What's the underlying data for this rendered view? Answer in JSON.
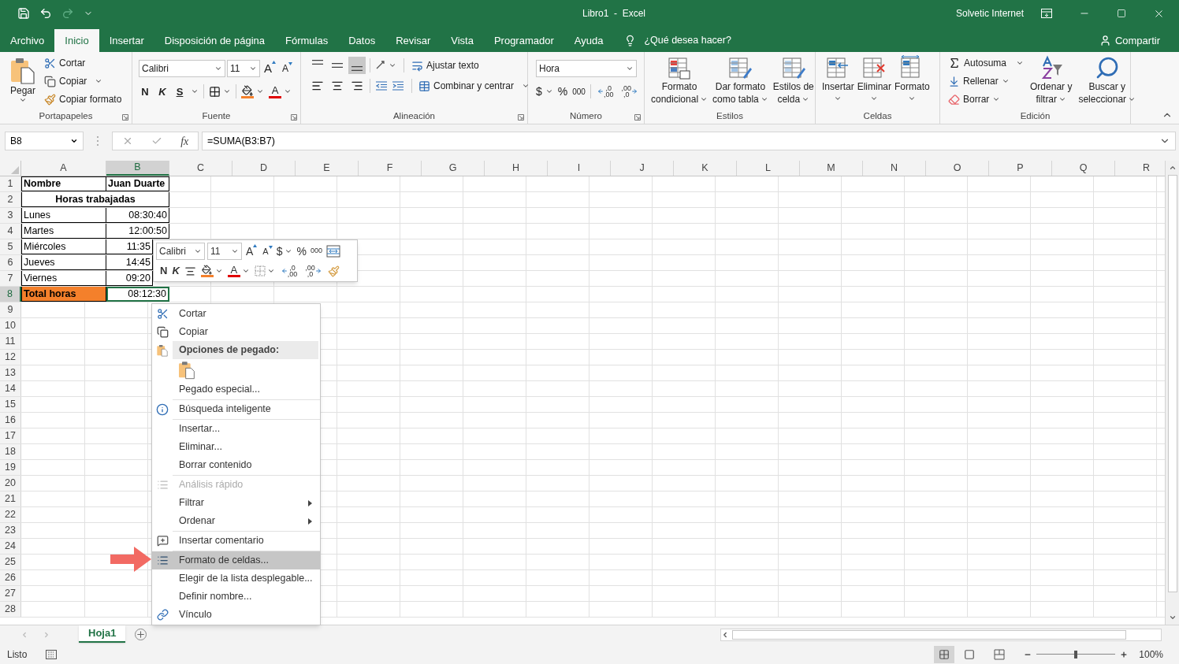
{
  "title_bar": {
    "title": "Libro1  -  Excel",
    "user": "Solvetic Internet"
  },
  "menu_tabs": [
    {
      "label": "Archivo",
      "selected": false
    },
    {
      "label": "Inicio",
      "selected": true
    },
    {
      "label": "Insertar",
      "selected": false
    },
    {
      "label": "Disposición de página",
      "selected": false
    },
    {
      "label": "Fórmulas",
      "selected": false
    },
    {
      "label": "Datos",
      "selected": false
    },
    {
      "label": "Revisar",
      "selected": false
    },
    {
      "label": "Vista",
      "selected": false
    },
    {
      "label": "Programador",
      "selected": false
    },
    {
      "label": "Ayuda",
      "selected": false
    }
  ],
  "tell_me": {
    "placeholder": "¿Qué desea hacer?"
  },
  "share": "Compartir",
  "ribbon": {
    "clipboard": {
      "label": "Portapapeles",
      "paste": "Pegar",
      "cut": "Cortar",
      "copy": "Copiar",
      "format_painter": "Copiar formato"
    },
    "font": {
      "label": "Fuente",
      "family": "Calibri",
      "size": "11",
      "grow": "A",
      "shrink": "A",
      "bold": "N",
      "italic": "K",
      "underline": "S",
      "font_color": "A"
    },
    "alignment": {
      "label": "Alineación",
      "vertical_align": [
        {
          "selected": false
        },
        {
          "selected": false
        },
        {
          "selected": true
        }
      ],
      "wrap": "Ajustar texto",
      "merge": "Combinar y centrar"
    },
    "number": {
      "label": "Número",
      "format": "Hora",
      "currency": "$",
      "percent": "%",
      "thousands": "000",
      "increase_decimal": [
        ",0",
        ",00"
      ],
      "decrease_decimal": [
        ",00",
        ",0"
      ]
    },
    "styles": {
      "label": "Estilos",
      "buttons": [
        {
          "lines": [
            "Formato",
            "condicional"
          ]
        },
        {
          "lines": [
            "Dar formato",
            "como tabla"
          ]
        },
        {
          "lines": [
            "Estilos de",
            "celda"
          ]
        }
      ]
    },
    "cells": {
      "label": "Celdas",
      "buttons": [
        "Insertar",
        "Eliminar",
        "Formato"
      ]
    },
    "editing": {
      "label": "Edición",
      "autosum": "Autosuma",
      "fill": "Rellenar",
      "clear": "Borrar",
      "sort": [
        "Ordenar y",
        "filtrar"
      ],
      "find": [
        "Buscar y",
        "seleccionar"
      ]
    }
  },
  "formula_bar": {
    "name_box": "B8",
    "function_label": "fx",
    "formula": "=SUMA(B3:B7)"
  },
  "sheet": {
    "columns": [
      {
        "label": "A",
        "selected": false
      },
      {
        "label": "B",
        "selected": true
      },
      {
        "label": "C",
        "selected": false
      },
      {
        "label": "D",
        "selected": false
      },
      {
        "label": "E",
        "selected": false
      },
      {
        "label": "F",
        "selected": false
      },
      {
        "label": "G",
        "selected": false
      },
      {
        "label": "H",
        "selected": false
      },
      {
        "label": "I",
        "selected": false
      },
      {
        "label": "J",
        "selected": false
      },
      {
        "label": "K",
        "selected": false
      },
      {
        "label": "L",
        "selected": false
      },
      {
        "label": "M",
        "selected": false
      },
      {
        "label": "N",
        "selected": false
      },
      {
        "label": "O",
        "selected": false
      },
      {
        "label": "P",
        "selected": false
      },
      {
        "label": "Q",
        "selected": false
      },
      {
        "label": "R",
        "selected": false
      }
    ],
    "rows": [
      {
        "number": "1",
        "selected": false,
        "cells": [
          {
            "text": "Nombre",
            "bold": true,
            "right_aligned": false,
            "merged": false,
            "selected": false
          },
          {
            "text": "Juan Duarte",
            "bold": true,
            "right_aligned": false,
            "merged": false,
            "selected": false
          }
        ]
      },
      {
        "number": "2",
        "selected": false,
        "cells": [
          {
            "text": "Horas trabajadas",
            "bold": true,
            "right_aligned": false,
            "merged": true,
            "selected": false
          }
        ]
      },
      {
        "number": "3",
        "selected": false,
        "cells": [
          {
            "text": "Lunes",
            "bold": false,
            "right_aligned": false,
            "merged": false,
            "selected": false
          },
          {
            "text": "08:30:40",
            "bold": false,
            "right_aligned": true,
            "merged": false,
            "selected": false
          }
        ]
      },
      {
        "number": "4",
        "selected": false,
        "cells": [
          {
            "text": "Martes",
            "bold": false,
            "right_aligned": false,
            "merged": false,
            "selected": false
          },
          {
            "text": "12:00:50",
            "bold": false,
            "right_aligned": true,
            "merged": false,
            "selected": false
          }
        ]
      },
      {
        "number": "5",
        "selected": false,
        "cells": [
          {
            "text": "Miércoles",
            "bold": false,
            "right_aligned": false,
            "merged": false,
            "selected": false
          },
          {
            "text": "11:35",
            "bold": false,
            "right_aligned": true,
            "merged": false,
            "selected": false,
            "partial": true
          }
        ]
      },
      {
        "number": "6",
        "selected": false,
        "cells": [
          {
            "text": "Jueves",
            "bold": false,
            "right_aligned": false,
            "merged": false,
            "selected": false
          },
          {
            "text": "14:45",
            "bold": false,
            "right_aligned": true,
            "merged": false,
            "selected": false,
            "partial": true
          }
        ]
      },
      {
        "number": "7",
        "selected": false,
        "cells": [
          {
            "text": "Viernes",
            "bold": false,
            "right_aligned": false,
            "merged": false,
            "selected": false
          },
          {
            "text": "09:20",
            "bold": false,
            "right_aligned": true,
            "merged": false,
            "selected": false,
            "partial": true
          }
        ]
      },
      {
        "number": "8",
        "selected": true,
        "cells": [
          {
            "text": "Total horas",
            "bold": true,
            "right_aligned": false,
            "merged": false,
            "selected": false,
            "color": "#f4802b"
          },
          {
            "text": "08:12:30",
            "bold": false,
            "right_aligned": true,
            "merged": false,
            "selected": true
          }
        ]
      },
      {
        "number": "9",
        "selected": false
      },
      {
        "number": "10",
        "selected": false
      },
      {
        "number": "11",
        "selected": false
      },
      {
        "number": "12",
        "selected": false
      },
      {
        "number": "13",
        "selected": false
      },
      {
        "number": "14",
        "selected": false
      },
      {
        "number": "15",
        "selected": false
      },
      {
        "number": "16",
        "selected": false
      },
      {
        "number": "17",
        "selected": false
      },
      {
        "number": "18",
        "selected": false
      },
      {
        "number": "19",
        "selected": false
      },
      {
        "number": "20",
        "selected": false
      },
      {
        "number": "21",
        "selected": false
      },
      {
        "number": "22",
        "selected": false
      },
      {
        "number": "23",
        "selected": false
      },
      {
        "number": "24",
        "selected": false
      },
      {
        "number": "25",
        "selected": false
      },
      {
        "number": "26",
        "selected": false
      },
      {
        "number": "27",
        "selected": false
      },
      {
        "number": "28",
        "selected": false
      }
    ]
  },
  "mini_toolbar": {
    "family": "Calibri",
    "size": "11",
    "grow": "A",
    "shrink": "A",
    "currency": "$",
    "percent": "%",
    "thousands": "000",
    "bold": "N",
    "italic": "K",
    "font_color": "A",
    "increase_decimal": [
      ",0",
      ",00"
    ],
    "decrease_decimal": [
      ",00",
      ",0"
    ]
  },
  "context_menu": [
    {
      "kind": "item",
      "label": "Cortar",
      "disabled": false,
      "selected": false,
      "submenu": false
    },
    {
      "kind": "item",
      "label": "Copiar",
      "disabled": false,
      "selected": false,
      "submenu": false
    },
    {
      "kind": "header",
      "label": "Opciones de pegado:"
    },
    {
      "kind": "paste_options"
    },
    {
      "kind": "item",
      "label": "Pegado especial...",
      "disabled": false,
      "selected": false,
      "submenu": false
    },
    {
      "kind": "separator"
    },
    {
      "kind": "item",
      "label": "Búsqueda inteligente",
      "disabled": false,
      "selected": false,
      "submenu": false
    },
    {
      "kind": "separator"
    },
    {
      "kind": "item",
      "label": "Insertar...",
      "disabled": false,
      "selected": false,
      "submenu": false
    },
    {
      "kind": "item",
      "label": "Eliminar...",
      "disabled": false,
      "selected": false,
      "submenu": false
    },
    {
      "kind": "item",
      "label": "Borrar contenido",
      "disabled": false,
      "selected": false,
      "submenu": false
    },
    {
      "kind": "separator"
    },
    {
      "kind": "item",
      "label": "Análisis rápido",
      "disabled": true,
      "selected": false,
      "submenu": false
    },
    {
      "kind": "item",
      "label": "Filtrar",
      "disabled": false,
      "selected": false,
      "submenu": true
    },
    {
      "kind": "item",
      "label": "Ordenar",
      "disabled": false,
      "selected": false,
      "submenu": true
    },
    {
      "kind": "separator"
    },
    {
      "kind": "item",
      "label": "Insertar comentario",
      "disabled": false,
      "selected": false,
      "submenu": false
    },
    {
      "kind": "separator"
    },
    {
      "kind": "item",
      "label": "Formato de celdas...",
      "disabled": false,
      "selected": true,
      "submenu": false
    },
    {
      "kind": "item",
      "label": "Elegir de la lista desplegable...",
      "disabled": false,
      "selected": false,
      "submenu": false
    },
    {
      "kind": "item",
      "label": "Definir nombre...",
      "disabled": false,
      "selected": false,
      "submenu": false
    },
    {
      "kind": "item",
      "label": "Vínculo",
      "disabled": false,
      "selected": false,
      "submenu": false
    }
  ],
  "sheet_tabs": [
    {
      "label": "Hoja1",
      "selected": true
    }
  ],
  "status_bar": {
    "status": "Listo",
    "zoom": {
      "level": 0.5,
      "reading": "100%"
    }
  }
}
